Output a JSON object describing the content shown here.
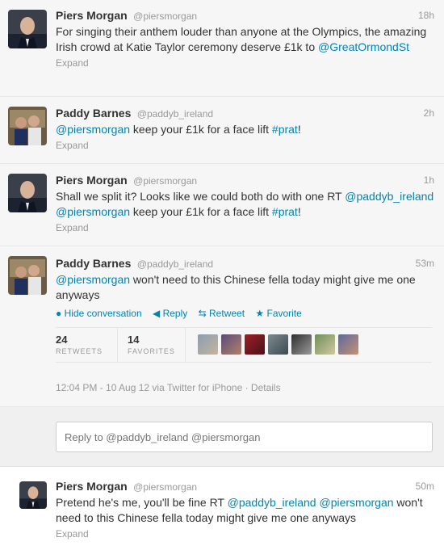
{
  "tweets": [
    {
      "name": "Piers Morgan",
      "handle": "@piersmorgan",
      "time": "18h",
      "text_1": "For singing their anthem louder than anyone at the Olympics, the amazing Irish crowd at Katie Taylor ceremony deserve £1k to ",
      "link_1": "@GreatOrmondSt",
      "expand": "Expand"
    },
    {
      "name": "Paddy Barnes",
      "handle": "@paddyb_ireland",
      "time": "2h",
      "link_1": "@piersmorgan",
      "text_1": " keep your £1k for a face lift ",
      "link_2": "#prat",
      "text_2": "!",
      "expand": "Expand"
    },
    {
      "name": "Piers Morgan",
      "handle": "@piersmorgan",
      "time": "1h",
      "text_1": "Shall we split it? Looks like we could both do with one RT ",
      "link_1": "@paddyb_ireland",
      "text_2": " ",
      "link_2": "@piersmorgan",
      "text_3": " keep your £1k for a face lift ",
      "link_3": "#prat",
      "text_4": "!",
      "expand": "Expand"
    },
    {
      "name": "Paddy Barnes",
      "handle": "@paddyb_ireland",
      "time": "53m",
      "link_1": "@piersmorgan",
      "text_1": " won't need to this Chinese fella today might give me one anyways",
      "actions": {
        "hide_conversation": "Hide conversation",
        "reply": "Reply",
        "retweet": "Retweet",
        "favorite": "Favorite"
      },
      "retweets_count": "24",
      "retweets_label": "RETWEETS",
      "favorites_count": "14",
      "favorites_label": "FAVORITES",
      "meta": "12:04 PM - 10 Aug 12 via Twitter for iPhone · Details"
    },
    {
      "name": "Piers Morgan",
      "handle": "@piersmorgan",
      "time": "50m",
      "text_1": "Pretend he's me, you'll be fine RT ",
      "link_1": "@paddyb_ireland",
      "text_2": " ",
      "link_2": "@piersmorgan",
      "text_3": " won't need to this Chinese fella today might give me one anyways",
      "expand": "Expand"
    }
  ],
  "reply_box": {
    "placeholder": "Reply to @paddyb_ireland @piersmorgan"
  },
  "colors": {
    "link": "#0084b4",
    "muted": "#999999",
    "text": "#333333"
  },
  "icons": {
    "hide_conversation": "speech-bubble-icon",
    "reply": "reply-arrow-icon",
    "retweet": "retweet-icon",
    "favorite": "star-icon"
  }
}
